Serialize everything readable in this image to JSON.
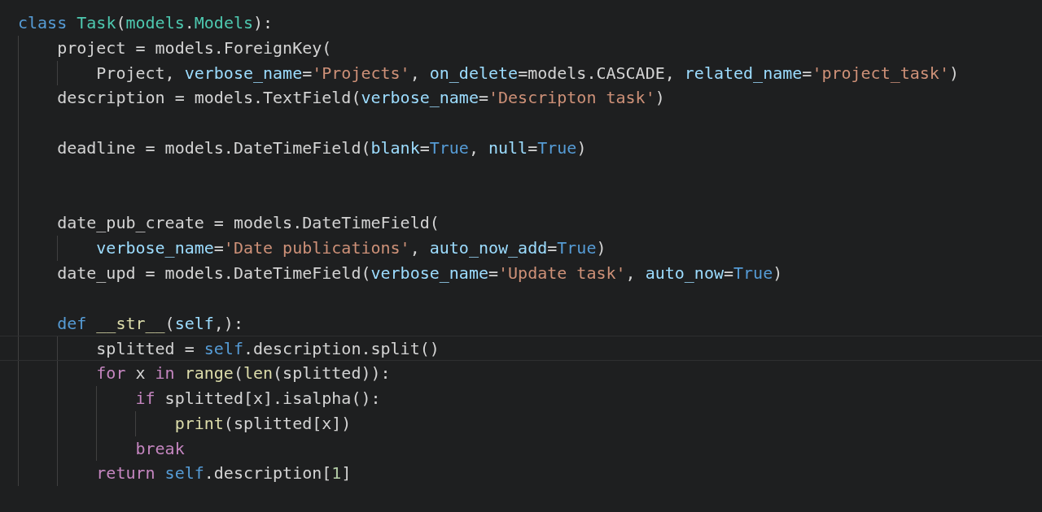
{
  "lines": [
    {
      "current": false,
      "tokens": [
        {
          "t": "class",
          "kind": "kw"
        },
        {
          "t": " Task",
          "kind": "cls"
        },
        {
          "t": "(",
          "kind": "plain"
        },
        {
          "t": "models",
          "kind": "cls"
        },
        {
          "t": ".",
          "kind": "plain"
        },
        {
          "t": "Models",
          "kind": "cls"
        },
        {
          "t": "):",
          "kind": "plain"
        }
      ],
      "children": [
        {
          "current": false,
          "tokens": [
            {
              "t": "project = models.ForeignKey(",
              "kind": "plain"
            }
          ],
          "children": [
            {
              "current": false,
              "tokens": [
                {
                  "t": "Project, ",
                  "kind": "plain"
                },
                {
                  "t": "verbose_name",
                  "kind": "param"
                },
                {
                  "t": "=",
                  "kind": "plain"
                },
                {
                  "t": "'Projects'",
                  "kind": "str"
                },
                {
                  "t": ", ",
                  "kind": "plain"
                },
                {
                  "t": "on_delete",
                  "kind": "param"
                },
                {
                  "t": "=models.CASCADE, ",
                  "kind": "plain"
                },
                {
                  "t": "related_name",
                  "kind": "param"
                },
                {
                  "t": "=",
                  "kind": "plain"
                },
                {
                  "t": "'project_task'",
                  "kind": "str"
                },
                {
                  "t": ")",
                  "kind": "plain"
                }
              ]
            }
          ]
        },
        {
          "current": false,
          "tokens": [
            {
              "t": "description = models.TextField(",
              "kind": "plain"
            },
            {
              "t": "verbose_name",
              "kind": "param"
            },
            {
              "t": "=",
              "kind": "plain"
            },
            {
              "t": "'Descripton task'",
              "kind": "str"
            },
            {
              "t": ")",
              "kind": "plain"
            }
          ]
        },
        {
          "current": false
        },
        {
          "current": false,
          "tokens": [
            {
              "t": "deadline = models.DateTimeField(",
              "kind": "plain"
            },
            {
              "t": "blank",
              "kind": "param"
            },
            {
              "t": "=",
              "kind": "plain"
            },
            {
              "t": "True",
              "kind": "kw"
            },
            {
              "t": ", ",
              "kind": "plain"
            },
            {
              "t": "null",
              "kind": "param"
            },
            {
              "t": "=",
              "kind": "plain"
            },
            {
              "t": "True",
              "kind": "kw"
            },
            {
              "t": ")",
              "kind": "plain"
            }
          ]
        },
        {
          "current": false
        },
        {
          "current": false
        },
        {
          "current": false,
          "tokens": [
            {
              "t": "date_pub_create = models.DateTimeField(",
              "kind": "plain"
            }
          ],
          "children": [
            {
              "current": false,
              "tokens": [
                {
                  "t": "verbose_name",
                  "kind": "param"
                },
                {
                  "t": "=",
                  "kind": "plain"
                },
                {
                  "t": "'Date publications'",
                  "kind": "str"
                },
                {
                  "t": ", ",
                  "kind": "plain"
                },
                {
                  "t": "auto_now_add",
                  "kind": "param"
                },
                {
                  "t": "=",
                  "kind": "plain"
                },
                {
                  "t": "True",
                  "kind": "kw"
                },
                {
                  "t": ")",
                  "kind": "plain"
                }
              ]
            }
          ]
        },
        {
          "current": false,
          "tokens": [
            {
              "t": "date_upd = models.DateTimeField(",
              "kind": "plain"
            },
            {
              "t": "verbose_name",
              "kind": "param"
            },
            {
              "t": "=",
              "kind": "plain"
            },
            {
              "t": "'Update task'",
              "kind": "str"
            },
            {
              "t": ", ",
              "kind": "plain"
            },
            {
              "t": "auto_now",
              "kind": "param"
            },
            {
              "t": "=",
              "kind": "plain"
            },
            {
              "t": "True",
              "kind": "kw"
            },
            {
              "t": ")",
              "kind": "plain"
            }
          ]
        },
        {
          "current": false
        },
        {
          "current": false,
          "tokens": [
            {
              "t": "def",
              "kind": "kw"
            },
            {
              "t": " __str__",
              "kind": "fn"
            },
            {
              "t": "(",
              "kind": "plain"
            },
            {
              "t": "self",
              "kind": "param"
            },
            {
              "t": ",):",
              "kind": "plain"
            }
          ],
          "children": [
            {
              "current": true,
              "tokens": [
                {
                  "t": "splitted = ",
                  "kind": "plain"
                },
                {
                  "t": "self",
                  "kind": "kw"
                },
                {
                  "t": ".description.split()",
                  "kind": "plain"
                }
              ]
            },
            {
              "current": false,
              "tokens": [
                {
                  "t": "for",
                  "kind": "ctrl"
                },
                {
                  "t": " x ",
                  "kind": "plain"
                },
                {
                  "t": "in",
                  "kind": "ctrl"
                },
                {
                  "t": " range",
                  "kind": "fn"
                },
                {
                  "t": "(",
                  "kind": "plain"
                },
                {
                  "t": "len",
                  "kind": "fn"
                },
                {
                  "t": "(splitted)):",
                  "kind": "plain"
                }
              ],
              "children": [
                {
                  "current": false,
                  "tokens": [
                    {
                      "t": "if",
                      "kind": "ctrl"
                    },
                    {
                      "t": " splitted[x].isalpha():",
                      "kind": "plain"
                    }
                  ],
                  "children": [
                    {
                      "current": false,
                      "tokens": [
                        {
                          "t": "print",
                          "kind": "fn"
                        },
                        {
                          "t": "(splitted[x])",
                          "kind": "plain"
                        }
                      ]
                    }
                  ]
                },
                {
                  "current": false,
                  "tokens": [
                    {
                      "t": "break",
                      "kind": "ctrl"
                    }
                  ]
                }
              ]
            },
            {
              "current": false,
              "tokens": [
                {
                  "t": "return",
                  "kind": "ctrl"
                },
                {
                  "t": " self",
                  "kind": "kw"
                },
                {
                  "t": ".description[",
                  "kind": "plain"
                },
                {
                  "t": "1",
                  "kind": "num"
                },
                {
                  "t": "]",
                  "kind": "plain"
                }
              ]
            }
          ]
        }
      ]
    }
  ]
}
